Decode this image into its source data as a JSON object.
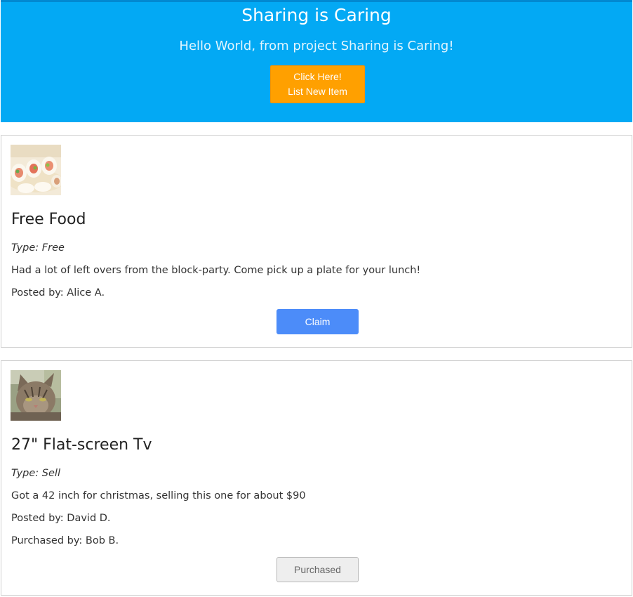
{
  "header": {
    "title": "Sharing is Caring",
    "subtitle": "Hello World, from project Sharing is Caring!",
    "button_line1": "Click Here!",
    "button_line2": "List New Item",
    "background_color": "#03a9f4",
    "button_color": "#ffa000"
  },
  "items": [
    {
      "image_icon": "sushi-photo",
      "title": "Free Food",
      "type": "Type: Free",
      "description": "Had a lot of left overs from the block-party. Come pick up a plate for your lunch!",
      "posted_by": "Posted by: Alice A.",
      "action_label": "Claim",
      "action_color": "#4c8cf9"
    },
    {
      "image_icon": "cat-photo",
      "title": "27\" Flat-screen Tv",
      "type": "Type: Sell",
      "description": "Got a 42 inch for christmas, selling this one for about $90",
      "posted_by": "Posted by: David D.",
      "purchased_by": "Purchased by: Bob B.",
      "action_label": "Purchased"
    }
  ]
}
